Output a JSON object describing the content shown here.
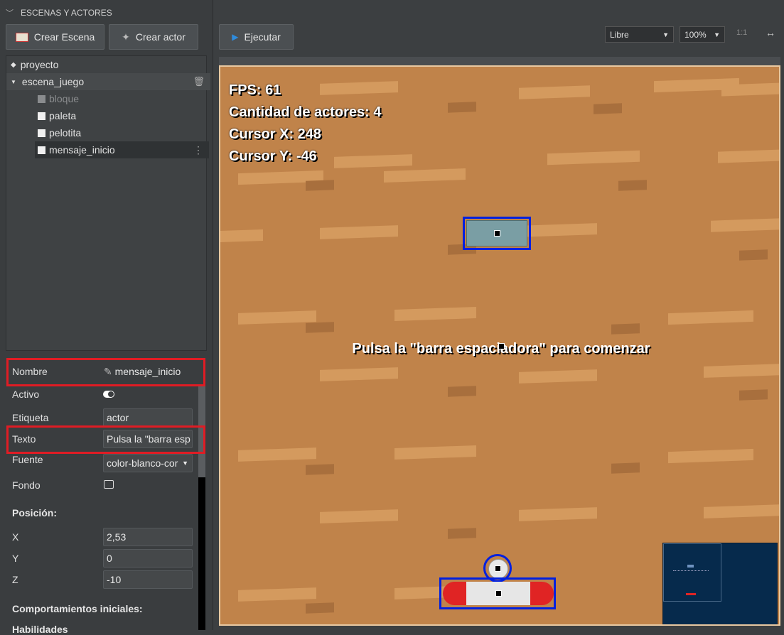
{
  "panel": {
    "title": "ESCENAS Y ACTORES",
    "create_scene": "Crear Escena",
    "create_actor": "Crear actor"
  },
  "tree": {
    "project": "proyecto",
    "scene": "escena_juego",
    "actors": [
      "bloque",
      "paleta",
      "pelotita",
      "mensaje_inicio"
    ]
  },
  "props": {
    "name_label": "Nombre",
    "name_value": "mensaje_inicio",
    "active_label": "Activo",
    "tag_label": "Etiqueta",
    "tag_value": "actor",
    "text_label": "Texto",
    "text_value": "Pulsa la \"barra esp",
    "font_label": "Fuente",
    "font_value": "color-blanco-cor",
    "bg_label": "Fondo",
    "position_title": "Posición:",
    "x_label": "X",
    "x_value": "2,53",
    "y_label": "Y",
    "y_value": "0",
    "z_label": "Z",
    "z_value": "-10",
    "behaviors_title": "Comportamientos iniciales:",
    "skills_title": "Habilidades"
  },
  "toolbar": {
    "run": "Ejecutar",
    "mode": "Libre",
    "zoom": "100%",
    "ratio": "1:1",
    "expand": "↔"
  },
  "game": {
    "fps": "FPS: 61",
    "actors": "Cantidad de actores: 4",
    "cursor_x": "Cursor X: 248",
    "cursor_y": "Cursor Y: -46",
    "message": "Pulsa la \"barra espaciadora\" para comenzar"
  },
  "colors": {
    "selection": "#0020e0",
    "highlight": "#e01c24",
    "accent": "#2e8bdc"
  }
}
